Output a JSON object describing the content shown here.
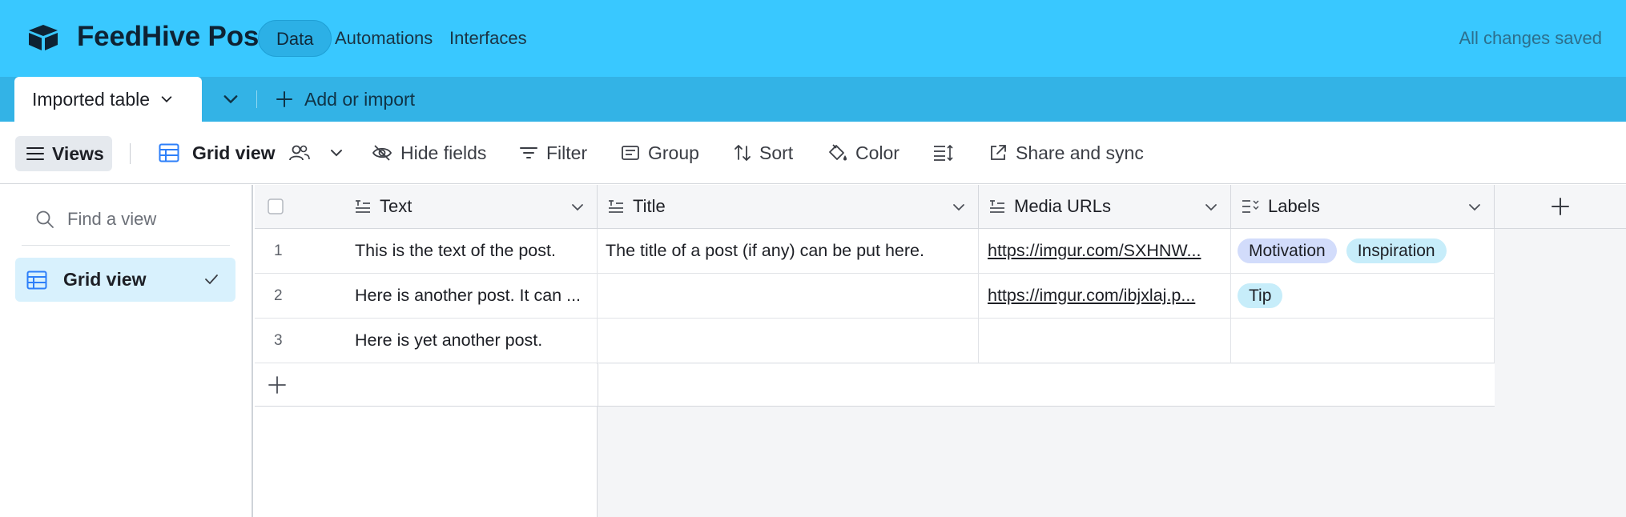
{
  "app": {
    "base_name": "FeedHive Posts",
    "nav": [
      "Data",
      "Automations",
      "Interfaces"
    ],
    "save_status": "All changes saved"
  },
  "tabs": {
    "active": "Imported table",
    "add_label": "Add or import"
  },
  "toolbar": {
    "views": "Views",
    "view_name": "Grid view",
    "hide_fields": "Hide fields",
    "filter": "Filter",
    "group": "Group",
    "sort": "Sort",
    "color": "Color",
    "share": "Share and sync"
  },
  "sidebar": {
    "search_placeholder": "Find a view",
    "items": [
      {
        "label": "Grid view",
        "selected": true
      }
    ]
  },
  "table": {
    "columns": [
      "Text",
      "Title",
      "Media URLs",
      "Labels"
    ],
    "rows": [
      {
        "num": "1",
        "text": "This is the text of the post.",
        "title": "The title of a post (if any) can be put here.",
        "media": "https://imgur.com/SXHNW...",
        "labels": [
          "Motivation",
          "Inspiration"
        ]
      },
      {
        "num": "2",
        "text": "Here is another post. It can ...",
        "title": "",
        "media": "https://imgur.com/ibjxlaj.p...",
        "labels": [
          "Tip"
        ]
      },
      {
        "num": "3",
        "text": "Here is yet another post.",
        "title": "",
        "media": "",
        "labels": []
      }
    ]
  },
  "colors": {
    "topbar": "#39c8ff",
    "tabbar": "#33b3e6",
    "label_motivation": "#d2dcfb",
    "label_inspiration": "#c7edfa",
    "label_tip": "#c7edfa",
    "selected_view": "#d8f1fd"
  }
}
